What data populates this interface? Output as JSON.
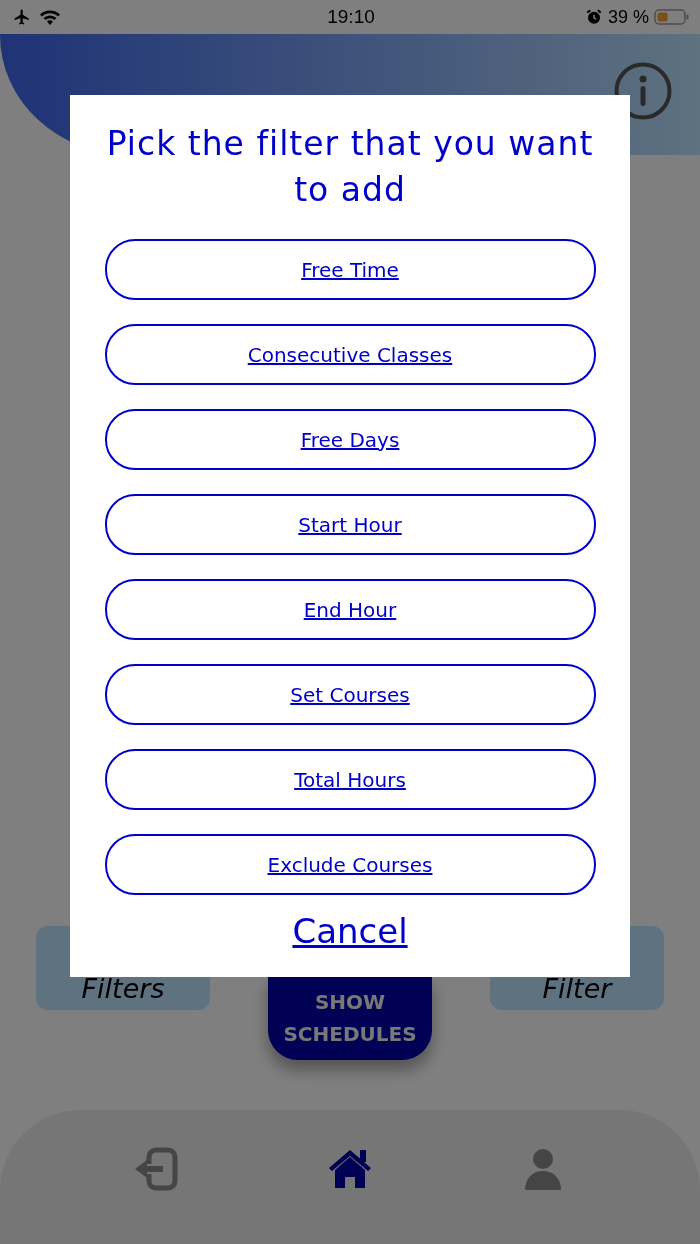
{
  "status_bar": {
    "time": "19:10",
    "battery": "39 %"
  },
  "actions": [
    {
      "label": "Filters"
    },
    {
      "label": "Filter"
    }
  ],
  "primary_button": {
    "label": "SHOW SCHEDULES"
  },
  "nav": [
    {
      "kind": "exit",
      "selected": false
    },
    {
      "kind": "home",
      "selected": true
    },
    {
      "kind": "user",
      "selected": false
    }
  ],
  "dialog": {
    "title": "Pick the filter that you want to add",
    "options": [
      "Free Time",
      "Consecutive Classes",
      "Free Days",
      "Start Hour",
      "End Hour",
      "Set Courses",
      "Total Hours",
      "Exclude Courses"
    ],
    "cancel": "Cancel"
  }
}
